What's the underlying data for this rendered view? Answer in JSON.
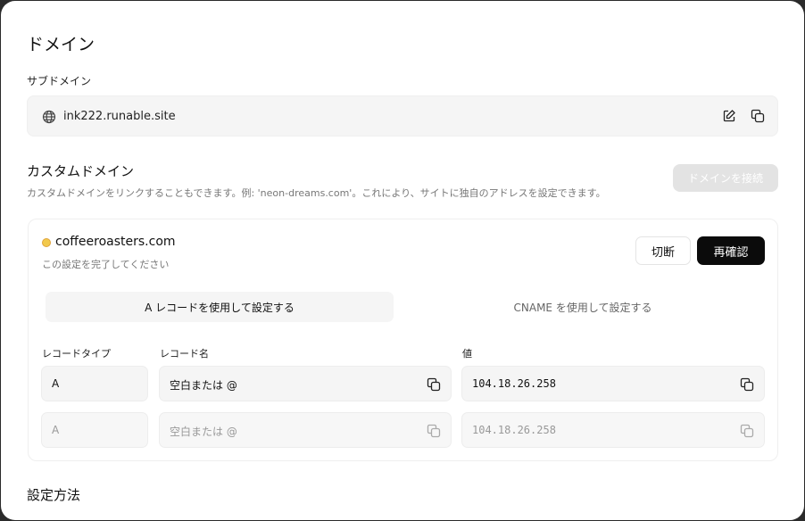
{
  "page": {
    "title": "ドメイン"
  },
  "subdomain": {
    "label": "サブドメイン",
    "value": "ink222.runable.site",
    "globe_icon": "globe-icon",
    "edit_icon": "edit-icon",
    "copy_icon": "copy-icon"
  },
  "custom_domain": {
    "title": "カスタムドメイン",
    "description": "カスタムドメインをリンクすることもできます。例: 'neon-dreams.com'。これにより、サイトに独自のアドレスを設定できます。",
    "connect_label": "ドメインを接続"
  },
  "domain_card": {
    "domain": "coffeeroasters.com",
    "status_text": "この設定を完了してください",
    "status_color": "#f2c94c",
    "disconnect_label": "切断",
    "recheck_label": "再確認",
    "tabs": [
      {
        "label": "A レコードを使用して設定する",
        "active": true
      },
      {
        "label": "CNAME を使用して設定する",
        "active": false
      }
    ],
    "columns": {
      "type": "レコードタイプ",
      "name": "レコード名",
      "value": "値"
    },
    "records": [
      {
        "type": "A",
        "name": "空白または @",
        "value": "104.18.26.258"
      },
      {
        "type": "A",
        "name": "空白または @",
        "value": "104.18.26.258"
      }
    ]
  },
  "setup": {
    "title": "設定方法"
  }
}
